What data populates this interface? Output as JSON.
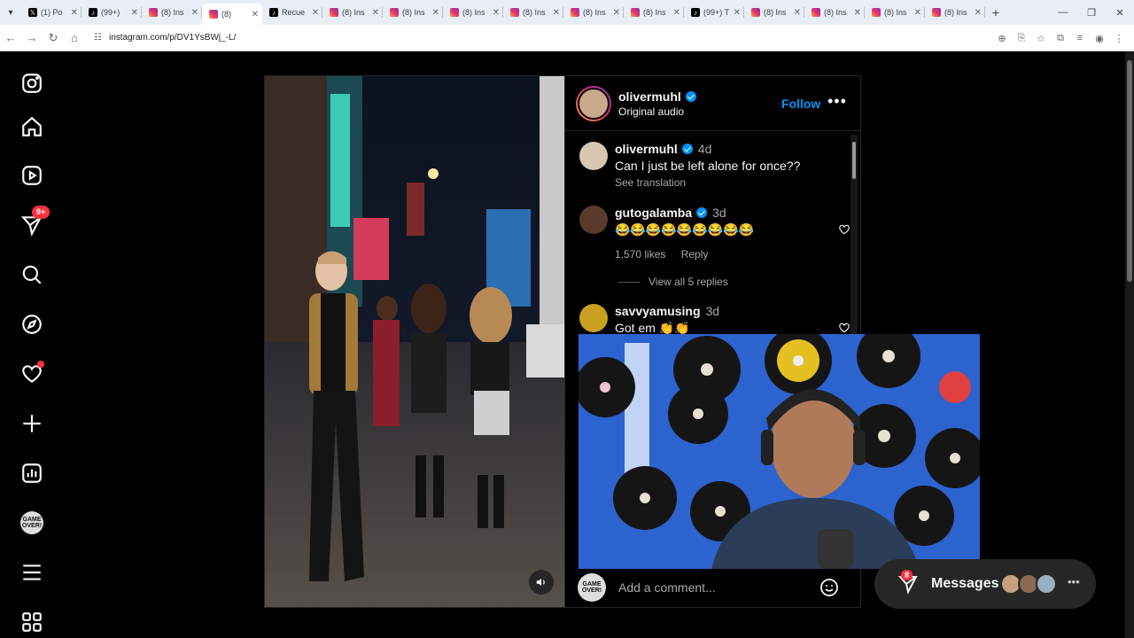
{
  "browser": {
    "tabs": [
      {
        "title": "(1) Po",
        "icon": "x-logo"
      },
      {
        "title": "(99+) ",
        "icon": "tiktok-logo"
      },
      {
        "title": "(8) Ins",
        "icon": "instagram-logo"
      },
      {
        "title": "(8)",
        "icon": "instagram-logo",
        "active": true
      },
      {
        "title": "Recue",
        "icon": "tiktok-logo"
      },
      {
        "title": "(8) Ins",
        "icon": "instagram-logo"
      },
      {
        "title": "(8) Ins",
        "icon": "instagram-logo"
      },
      {
        "title": "(8) Ins",
        "icon": "instagram-logo"
      },
      {
        "title": "(8) Ins",
        "icon": "instagram-logo"
      },
      {
        "title": "(8) Ins",
        "icon": "instagram-logo"
      },
      {
        "title": "(8) Ins",
        "icon": "instagram-logo"
      },
      {
        "title": "(99+) T",
        "icon": "tiktok-logo"
      },
      {
        "title": "(8) Ins",
        "icon": "instagram-logo"
      },
      {
        "title": "(8) Ins",
        "icon": "instagram-logo"
      },
      {
        "title": "(8) Ins",
        "icon": "instagram-logo"
      },
      {
        "title": "(8) Ins",
        "icon": "instagram-logo"
      }
    ],
    "url": "instagram.com/p/DV1YsBWj_-L/"
  },
  "sidebar": {
    "notifications_badge": "9+",
    "avatar_text": "GAME OVER!"
  },
  "post": {
    "author": {
      "username": "olivermuhl",
      "audio": "Original audio"
    },
    "follow_label": "Follow",
    "comments": [
      {
        "username": "olivermuhl",
        "time": "4d",
        "text": "Can I just be left alone for once??",
        "sub": "See translation"
      },
      {
        "username": "gutogalamba",
        "time": "3d",
        "text": "😂😂😂😂😂😂😂😂😂",
        "likes": "1,570 likes",
        "reply": "Reply",
        "view_replies": "View all 5 replies"
      },
      {
        "username": "savvyamusing",
        "time": "3d",
        "text": "Got em 👏👏"
      }
    ],
    "comment_placeholder": "Add a comment...",
    "commenter_avatar_text": "GAME OVER!"
  },
  "messages": {
    "label": "Messages",
    "badge": "8"
  },
  "colors": {
    "accent": "#0095f6",
    "badge": "#ff3040",
    "bg": "#000000"
  }
}
